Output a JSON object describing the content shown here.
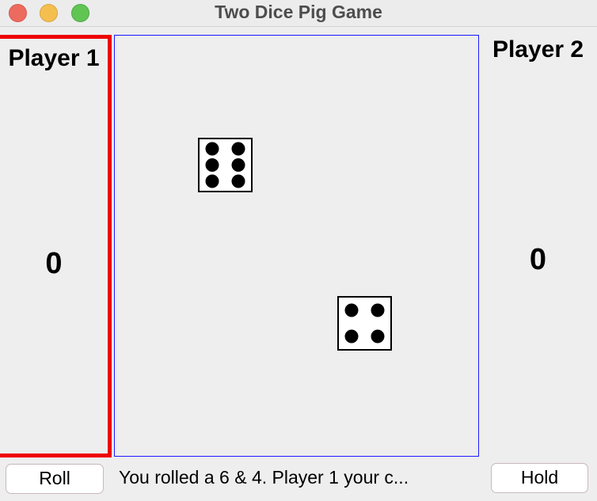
{
  "window": {
    "title": "Two Dice Pig Game"
  },
  "players": {
    "player1": {
      "name": "Player 1",
      "score": "0",
      "active": true
    },
    "player2": {
      "name": "Player 2",
      "score": "0",
      "active": false
    }
  },
  "dice": [
    {
      "value": 6
    },
    {
      "value": 4
    }
  ],
  "controls": {
    "roll_label": "Roll",
    "hold_label": "Hold",
    "status": "You rolled a 6 & 4. Player 1 your c..."
  },
  "colors": {
    "active_player_border": "#ee0000",
    "board_border": "#1a1aff",
    "background": "#eeeeee"
  }
}
